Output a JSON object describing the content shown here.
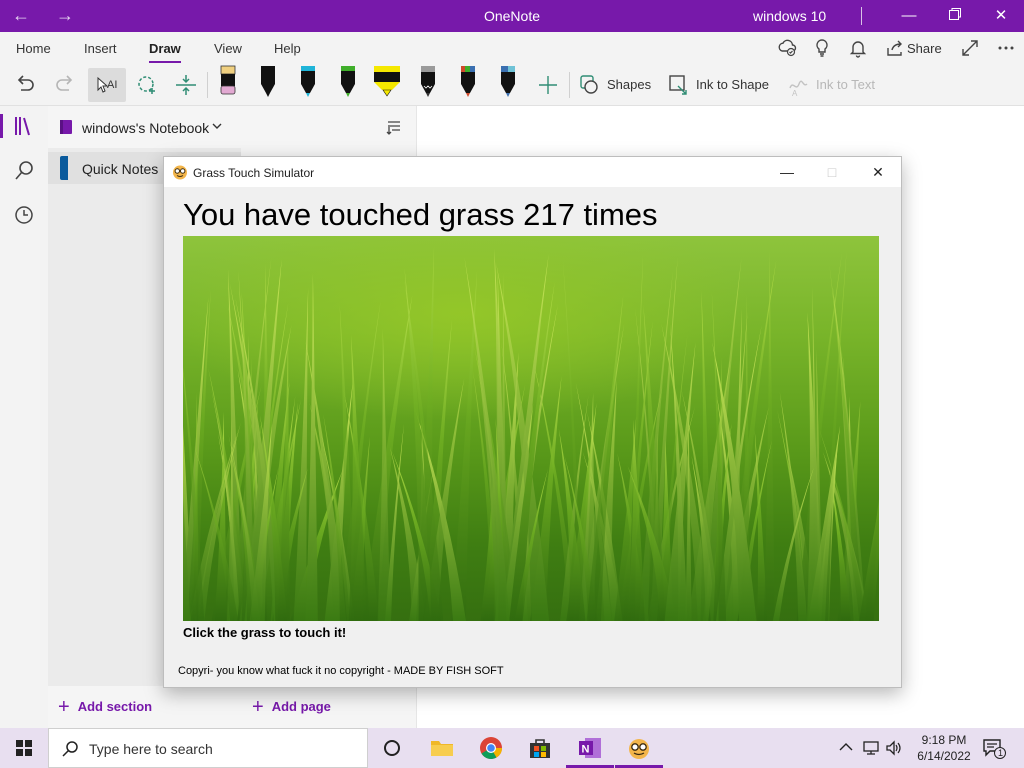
{
  "app": {
    "title": "OneNote",
    "user": "windows 10"
  },
  "ribbon": {
    "tabs": [
      "Home",
      "Insert",
      "Draw",
      "View",
      "Help"
    ],
    "active_tab": "Draw",
    "share_label": "Share"
  },
  "toolbar": {
    "shapes_label": "Shapes",
    "ink_to_shape_label": "Ink to Shape",
    "ink_to_text_label": "Ink to Text",
    "pens": [
      {
        "name": "eraser",
        "color": "#e2a9d2"
      },
      {
        "name": "black-pen",
        "color": "#111111"
      },
      {
        "name": "cyan-pen",
        "color": "#1fb4d8"
      },
      {
        "name": "green-pen",
        "color": "#3fae2a"
      },
      {
        "name": "yellow-highlighter",
        "color": "#f5e800"
      },
      {
        "name": "galaxy-pen",
        "color": "#8a8a8a"
      },
      {
        "name": "rainbow-pen",
        "color": "#d04a2a"
      },
      {
        "name": "ocean-pen",
        "color": "#3a6fb0"
      }
    ]
  },
  "notebook": {
    "title": "windows's Notebook",
    "sections": [
      {
        "label": "Quick Notes",
        "color": "#0a5a9c"
      }
    ],
    "add_section_label": "Add section",
    "add_page_label": "Add page"
  },
  "dialog": {
    "title": "Grass Touch Simulator",
    "counter_text": "You have touched grass 217 times",
    "instruction": "Click the grass to touch it!",
    "copyright": "Copyri- you know what fuck it no copyright - MADE BY FISH SOFT"
  },
  "taskbar": {
    "search_placeholder": "Type here to search",
    "time": "9:18 PM",
    "date": "6/14/2022",
    "notification_count": "1"
  },
  "colors": {
    "accent": "#7719aa",
    "section_blue": "#0a5a9c"
  }
}
